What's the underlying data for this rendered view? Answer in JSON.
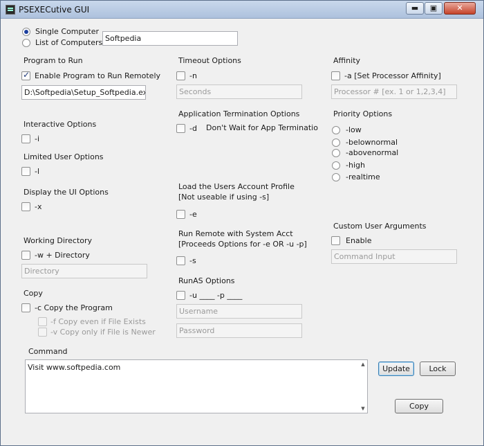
{
  "window": {
    "title": "PSEXECutive GUI",
    "icon": "app-terminal-icon",
    "controls": {
      "minimize": "▬",
      "maximize": "▣",
      "close": "✕"
    }
  },
  "target": {
    "single_label": "Single Computer",
    "list_label": "List of Computers",
    "computer_value": "Softpedia",
    "selected": "single"
  },
  "program": {
    "heading": "Program to Run",
    "enable_label": "Enable Program to Run Remotely",
    "enable_checked": true,
    "path_value": "D:\\Softpedia\\Setup_Softpedia.exe"
  },
  "interactive": {
    "heading": "Interactive Options",
    "flag": "-i"
  },
  "limited": {
    "heading": "Limited User Options",
    "flag": "-l"
  },
  "display_ui": {
    "heading": "Display the UI Options",
    "flag": "-x"
  },
  "working_dir": {
    "heading": "Working Directory",
    "flag": "-w + Directory",
    "placeholder": "Directory"
  },
  "copy": {
    "heading": "Copy",
    "flag": "-c Copy the Program",
    "f_label": "-f  Copy even if File Exists",
    "v_label": "-v  Copy only if File is Newer"
  },
  "timeout": {
    "heading": "Timeout Options",
    "flag": "-n",
    "placeholder": "Seconds"
  },
  "app_termination": {
    "heading": "Application Termination Options",
    "flag": "-d",
    "desc": "Don't Wait for App Terminatio"
  },
  "load_profile": {
    "heading_line1": "Load the Users Account Profile",
    "heading_line2": "[Not useable if using -s]",
    "flag": "-e"
  },
  "run_system": {
    "heading_line1": "Run Remote with System Acct",
    "heading_line2": "[Proceeds Options for -e OR -u -p]",
    "flag": "-s"
  },
  "runas": {
    "heading": "RunAS Options",
    "flag": "-u ____  -p ____",
    "username_placeholder": "Username",
    "password_placeholder": "Password"
  },
  "affinity": {
    "heading": "Affinity",
    "flag": "-a [Set Processor Affinity]",
    "placeholder": "Processor # [ex. 1  or  1,2,3,4]"
  },
  "priority": {
    "heading": "Priority Options",
    "options": [
      "-low",
      "-belownormal",
      "-abovenormal",
      "-high",
      "-realtime"
    ]
  },
  "custom_args": {
    "heading": "Custom User Arguments",
    "enable_label": "Enable",
    "placeholder": "Command Input"
  },
  "command": {
    "heading": "Command",
    "value": "Visit www.softpedia.com"
  },
  "buttons": {
    "update": "Update",
    "lock": "Lock",
    "copy": "Copy"
  },
  "colors": {
    "title_bar": "#bdcde4",
    "close_button": "#c5432a",
    "form_bg": "#f0f0f0",
    "radio_selected": "#1c3f9e"
  }
}
